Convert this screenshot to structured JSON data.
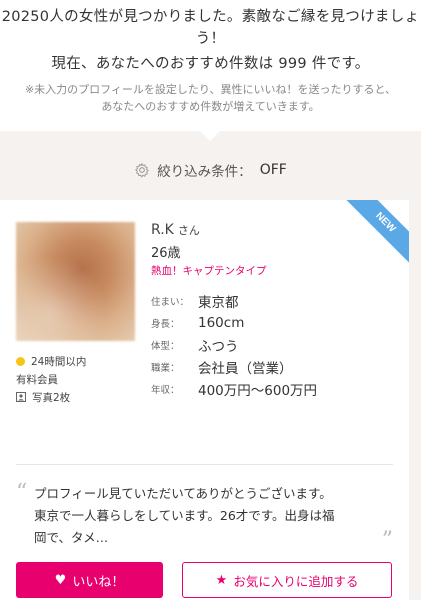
{
  "summary": {
    "headline_line1": "20250人の女性が見つかりました。素敵なご縁を見つけましょ",
    "headline_line1b": "う！",
    "headline_line2": "現在、あなたへのおすすめ件数は 999 件です。",
    "note_line1": "※未入力のプロフィールを設定したり、異性にいいね！を送ったりすると、",
    "note_line2": "あなたへのおすすめ件数が増えていきます。"
  },
  "filter": {
    "label": "絞り込み条件：",
    "value": "OFF",
    "icon": "gear-icon"
  },
  "profile": {
    "badge": "NEW",
    "name": "R.K",
    "honorific": "さん",
    "age": "26歳",
    "tagline": "熱血！キャプテンタイプ",
    "login_status": "24時間以内",
    "membership": "有料会員",
    "photos": "写真2枚",
    "status_color": "#f5c518",
    "attributes": [
      {
        "key": "住まい：",
        "value": "東京都"
      },
      {
        "key": "身長：",
        "value": "160cm"
      },
      {
        "key": "体型：",
        "value": "ふつう"
      },
      {
        "key": "職業：",
        "value": "会社員（営業）"
      },
      {
        "key": "年収：",
        "value": "400万円〜600万円"
      }
    ],
    "intro_line1": "プロフィール見ていただいてありがとうございます。",
    "intro_line2": "東京で一人暮らしをしています。26才です。出身は福",
    "intro_line3": "岡で、タメ…"
  },
  "actions": {
    "like_label": "いいね！",
    "favorite_label": "お気に入りに追加する",
    "accent_color": "#e8006f"
  }
}
